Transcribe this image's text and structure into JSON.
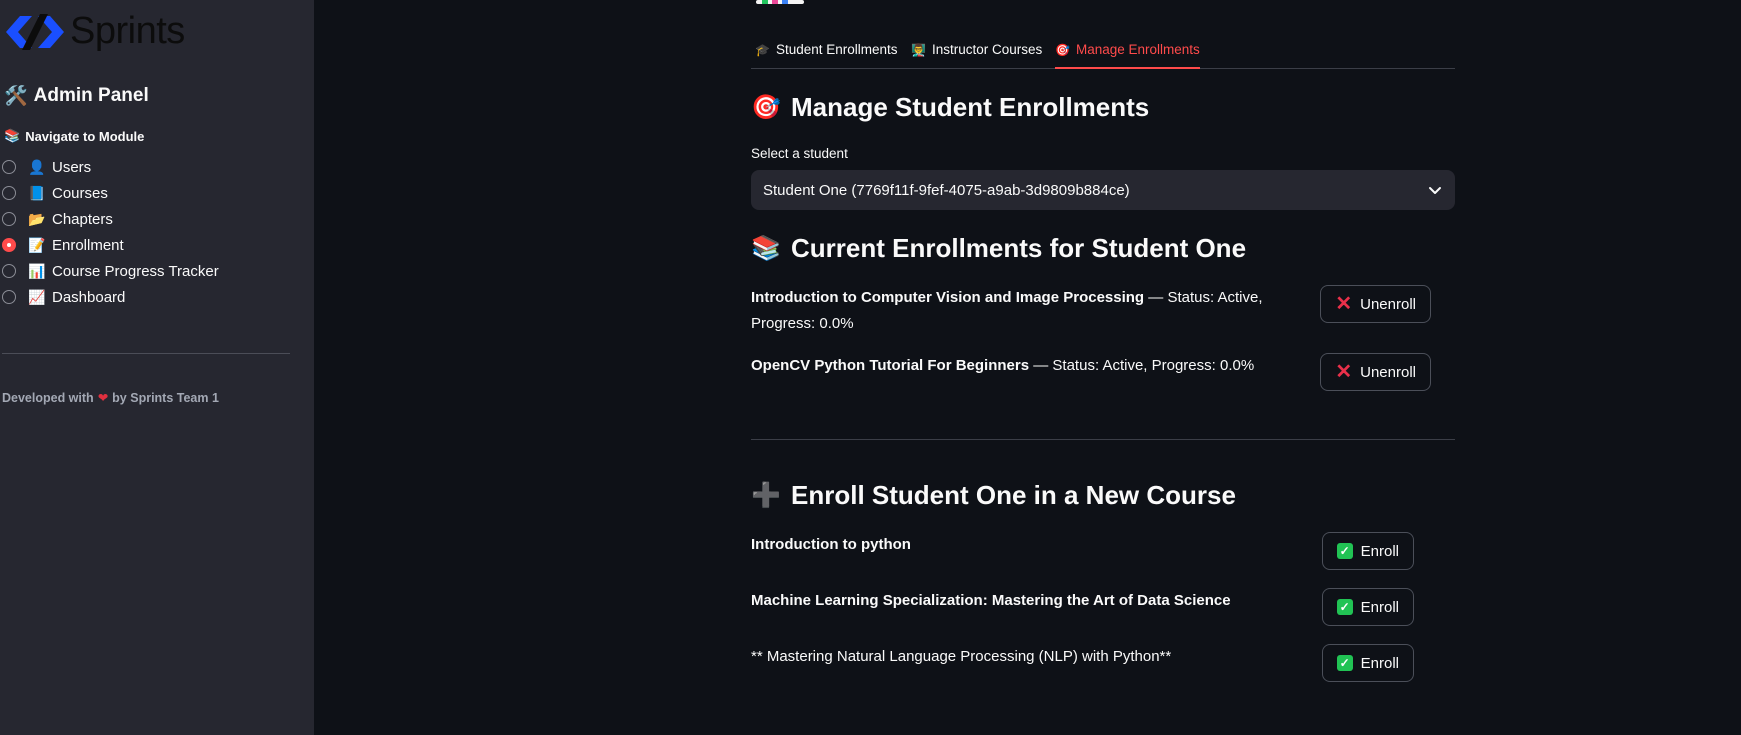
{
  "sidebar": {
    "logo_text": "Sprints",
    "admin_title": "Admin Panel",
    "admin_icon": "tools-icon",
    "nav_label": "Navigate to Module",
    "nav_label_icon": "books-icon",
    "items": [
      {
        "label": "Users",
        "icon": "👤",
        "checked": false
      },
      {
        "label": "Courses",
        "icon": "📘",
        "checked": false
      },
      {
        "label": "Chapters",
        "icon": "📂",
        "checked": false
      },
      {
        "label": "Enrollment",
        "icon": "📝",
        "checked": true
      },
      {
        "label": "Course Progress Tracker",
        "icon": "📊",
        "checked": false
      },
      {
        "label": "Dashboard",
        "icon": "📈",
        "checked": false
      }
    ],
    "credits_prefix": "Developed with",
    "credits_suffix": "by Sprints Team 1"
  },
  "tabs": [
    {
      "label": "Student Enrollments",
      "icon": "🎓",
      "active": false
    },
    {
      "label": "Instructor Courses",
      "icon": "👨‍🏫",
      "active": false
    },
    {
      "label": "Manage Enrollments",
      "icon": "🎯",
      "active": true
    }
  ],
  "manage": {
    "title": "Manage Student Enrollments",
    "title_icon": "🎯",
    "select_label": "Select a student",
    "selected_student": "Student One (7769f11f-9fef-4075-a9ab-3d9809b884ce)"
  },
  "current": {
    "title": "Current Enrollments for Student One",
    "title_icon": "📚",
    "unenroll_label": "Unenroll",
    "items": [
      {
        "course": "Introduction to Computer Vision and Image Processing",
        "details": " — Status: Active, Progress: 0.0%"
      },
      {
        "course": "OpenCV Python Tutorial For Beginners",
        "details": " — Status: Active, Progress: 0.0%"
      }
    ]
  },
  "enroll": {
    "title": "Enroll Student One in a New Course",
    "title_icon": "➕",
    "enroll_label": "Enroll",
    "courses": [
      {
        "name": "Introduction to python",
        "bold": true
      },
      {
        "name": "Machine Learning Specialization: Mastering the Art of Data Science",
        "bold": true
      },
      {
        "name": "** Mastering Natural Language Processing (NLP) with Python**",
        "bold": false
      }
    ]
  },
  "colors": {
    "accent": "#ff4b4b",
    "sidebar_bg": "#262730",
    "main_bg": "#0e1117",
    "logo_blue": "#1a4fff"
  }
}
